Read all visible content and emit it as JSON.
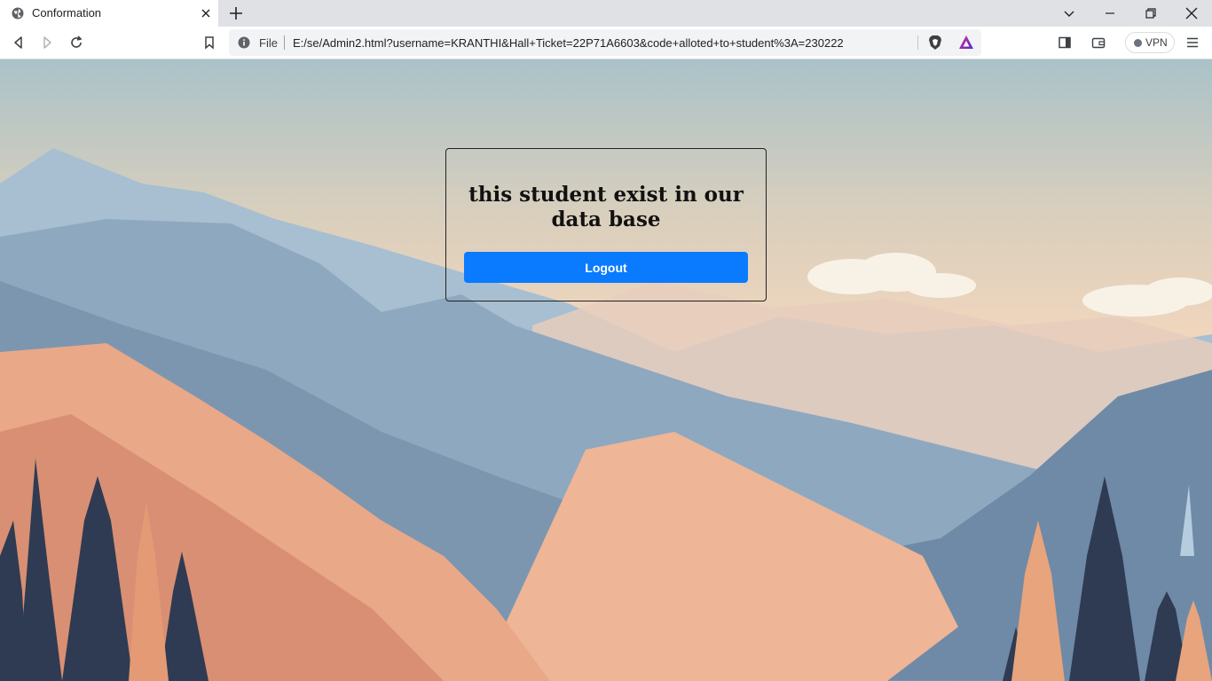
{
  "browser": {
    "tab": {
      "title": "Conformation",
      "favicon": "globe-icon"
    },
    "url_scheme": "File",
    "url": "E:/se/Admin2.html?username=KRANTHI&Hall+Ticket=22P71A6603&code+alloted+to+student%3A=230222",
    "vpn_label": "VPN",
    "icons": [
      "back-icon",
      "forward-icon",
      "reload-icon",
      "bookmark-icon",
      "info-icon",
      "brave-shield-icon",
      "brave-rewards-icon",
      "sidebar-icon",
      "wallet-icon",
      "menu-icon",
      "tab-search-icon",
      "minimize-icon",
      "restore-icon",
      "close-window-icon",
      "new-tab-icon",
      "close-tab-icon"
    ]
  },
  "page": {
    "message": "this student exist in our data base",
    "logout_label": "Logout",
    "colors": {
      "button": "#0a7bff",
      "border": "#222222"
    }
  }
}
